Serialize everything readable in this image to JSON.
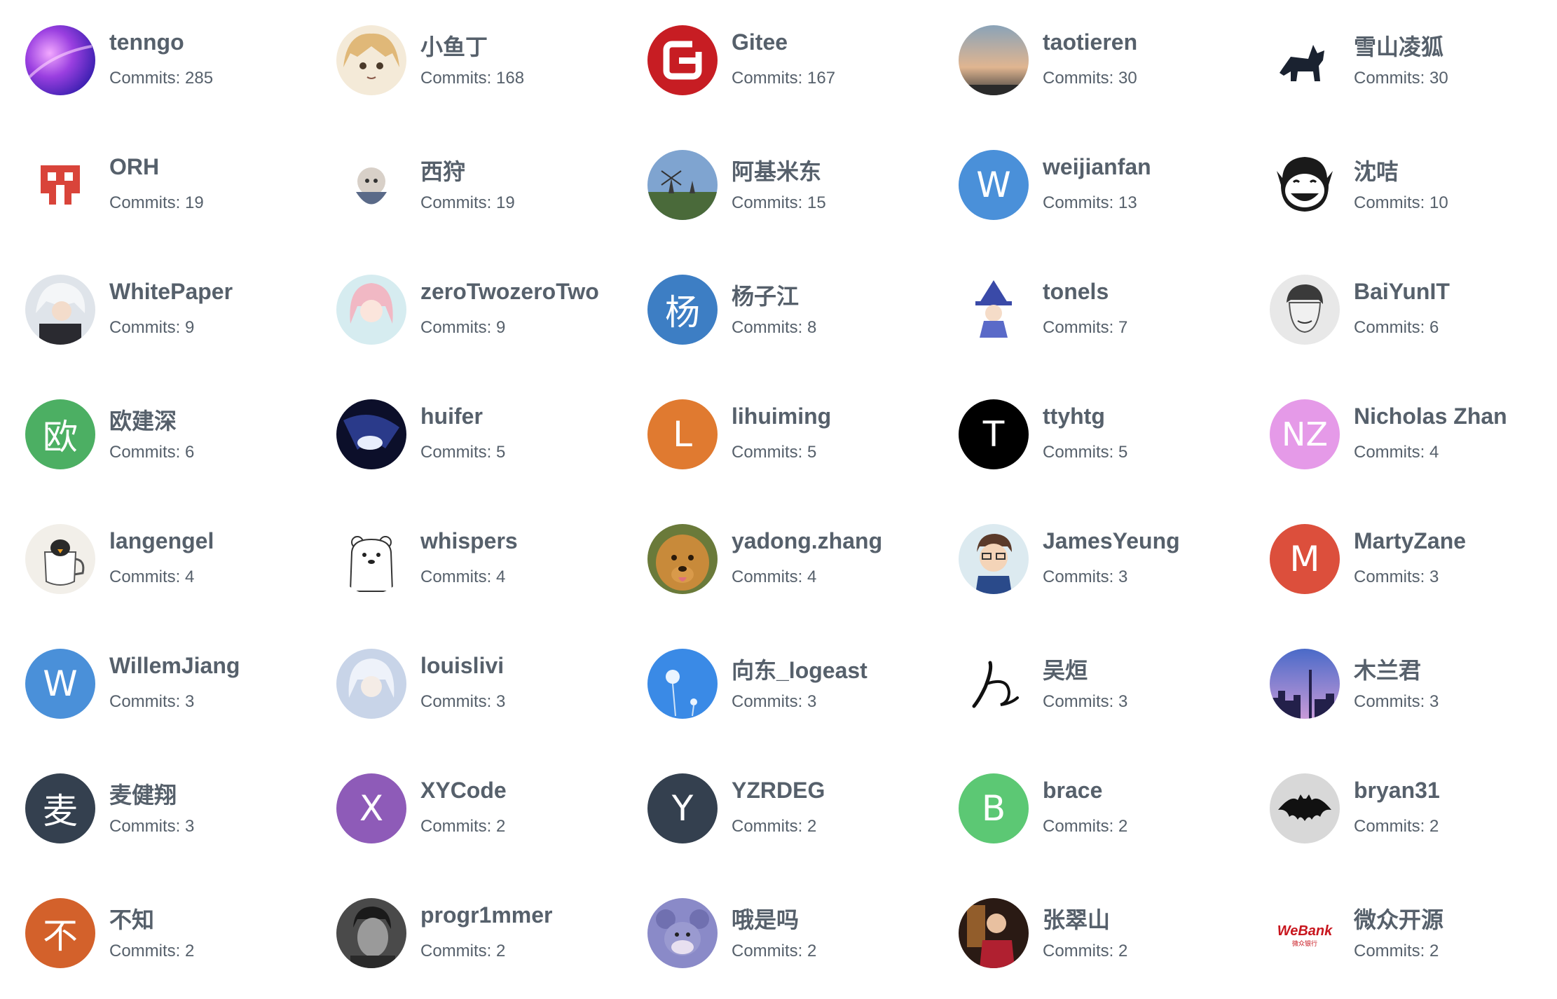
{
  "commits_prefix": "Commits: ",
  "contributors": [
    {
      "name": "tenngo",
      "commits": 285,
      "avatar": {
        "type": "image",
        "icon": "purple-galaxy-avatar"
      }
    },
    {
      "name": "小鱼丁",
      "commits": 168,
      "avatar": {
        "type": "image",
        "icon": "anime-girl-avatar"
      }
    },
    {
      "name": "Gitee",
      "commits": 167,
      "avatar": {
        "type": "image",
        "icon": "gitee-logo-avatar"
      }
    },
    {
      "name": "taotieren",
      "commits": 30,
      "avatar": {
        "type": "image",
        "icon": "sunset-sky-avatar"
      }
    },
    {
      "name": "雪山凌狐",
      "commits": 30,
      "avatar": {
        "type": "image",
        "icon": "black-fox-avatar"
      }
    },
    {
      "name": "ORH",
      "commits": 19,
      "avatar": {
        "type": "image",
        "icon": "red-pixel-logo-avatar"
      }
    },
    {
      "name": "西狩",
      "commits": 19,
      "avatar": {
        "type": "image",
        "icon": "anime-character-avatar"
      }
    },
    {
      "name": "阿基米东",
      "commits": 15,
      "avatar": {
        "type": "image",
        "icon": "windmill-landscape-avatar"
      }
    },
    {
      "name": "weijianfan",
      "commits": 13,
      "avatar": {
        "type": "letter",
        "letter": "W",
        "color": "#4a90d9"
      }
    },
    {
      "name": "沈咭",
      "commits": 10,
      "avatar": {
        "type": "image",
        "icon": "laughing-face-sketch-avatar"
      }
    },
    {
      "name": "WhitePaper",
      "commits": 9,
      "avatar": {
        "type": "image",
        "icon": "white-hair-anime-avatar"
      }
    },
    {
      "name": "zeroTwozeroTwo",
      "commits": 9,
      "avatar": {
        "type": "image",
        "icon": "pink-hair-anime-avatar"
      }
    },
    {
      "name": "杨子江",
      "commits": 8,
      "avatar": {
        "type": "letter",
        "letter": "杨",
        "color": "#3d7ec4"
      }
    },
    {
      "name": "tonels",
      "commits": 7,
      "avatar": {
        "type": "image",
        "icon": "witch-cartoon-avatar"
      }
    },
    {
      "name": "BaiYunIT",
      "commits": 6,
      "avatar": {
        "type": "image",
        "icon": "sketch-man-avatar"
      }
    },
    {
      "name": "欧建深",
      "commits": 6,
      "avatar": {
        "type": "letter",
        "letter": "欧",
        "color": "#4caf63"
      }
    },
    {
      "name": "huifer",
      "commits": 5,
      "avatar": {
        "type": "image",
        "icon": "dark-anime-avatar"
      }
    },
    {
      "name": "lihuiming",
      "commits": 5,
      "avatar": {
        "type": "letter",
        "letter": "L",
        "color": "#e07a30"
      }
    },
    {
      "name": "ttyhtg",
      "commits": 5,
      "avatar": {
        "type": "letter",
        "letter": "T",
        "color": "#000000"
      }
    },
    {
      "name": "Nicholas Zhan",
      "commits": 4,
      "avatar": {
        "type": "letter",
        "letter": "NZ",
        "color": "#e59ae8"
      }
    },
    {
      "name": "langengel",
      "commits": 4,
      "avatar": {
        "type": "image",
        "icon": "penguin-teapot-avatar"
      }
    },
    {
      "name": "whispers",
      "commits": 4,
      "avatar": {
        "type": "image",
        "icon": "polar-bear-avatar"
      }
    },
    {
      "name": "yadong.zhang",
      "commits": 4,
      "avatar": {
        "type": "image",
        "icon": "golden-dog-avatar"
      }
    },
    {
      "name": "JamesYeung",
      "commits": 3,
      "avatar": {
        "type": "image",
        "icon": "cartoon-man-glasses-avatar"
      }
    },
    {
      "name": "MartyZane",
      "commits": 3,
      "avatar": {
        "type": "letter",
        "letter": "M",
        "color": "#dc4f3c"
      }
    },
    {
      "name": "WillemJiang",
      "commits": 3,
      "avatar": {
        "type": "letter",
        "letter": "W",
        "color": "#4a90d9"
      }
    },
    {
      "name": "louislivi",
      "commits": 3,
      "avatar": {
        "type": "image",
        "icon": "blue-anime-avatar"
      }
    },
    {
      "name": "向东_logeast",
      "commits": 3,
      "avatar": {
        "type": "image",
        "icon": "dandelion-avatar"
      }
    },
    {
      "name": "吴烜",
      "commits": 3,
      "avatar": {
        "type": "image",
        "icon": "calligraphy-stroke-avatar"
      }
    },
    {
      "name": "木兰君",
      "commits": 3,
      "avatar": {
        "type": "image",
        "icon": "city-skyline-avatar"
      }
    },
    {
      "name": "麦健翔",
      "commits": 3,
      "avatar": {
        "type": "letter",
        "letter": "麦",
        "color": "#34404f"
      }
    },
    {
      "name": "XYCode",
      "commits": 2,
      "avatar": {
        "type": "letter",
        "letter": "X",
        "color": "#8e5bb8"
      }
    },
    {
      "name": "YZRDEG",
      "commits": 2,
      "avatar": {
        "type": "letter",
        "letter": "Y",
        "color": "#34404f"
      }
    },
    {
      "name": "brace",
      "commits": 2,
      "avatar": {
        "type": "letter",
        "letter": "B",
        "color": "#5cc874"
      }
    },
    {
      "name": "bryan31",
      "commits": 2,
      "avatar": {
        "type": "image",
        "icon": "batman-logo-avatar"
      }
    },
    {
      "name": "不知",
      "commits": 2,
      "avatar": {
        "type": "letter",
        "letter": "不",
        "color": "#d3612b"
      }
    },
    {
      "name": "progr1mmer",
      "commits": 2,
      "avatar": {
        "type": "image",
        "icon": "grayscale-portrait-avatar"
      }
    },
    {
      "name": "哦是吗",
      "commits": 2,
      "avatar": {
        "type": "image",
        "icon": "cartoon-mouse-avatar"
      }
    },
    {
      "name": "张翠山",
      "commits": 2,
      "avatar": {
        "type": "image",
        "icon": "person-photo-avatar"
      }
    },
    {
      "name": "微众开源",
      "commits": 2,
      "avatar": {
        "type": "image",
        "icon": "webank-logo-avatar",
        "logo_text": "WeBank",
        "logo_subtext": "微众银行"
      }
    }
  ]
}
